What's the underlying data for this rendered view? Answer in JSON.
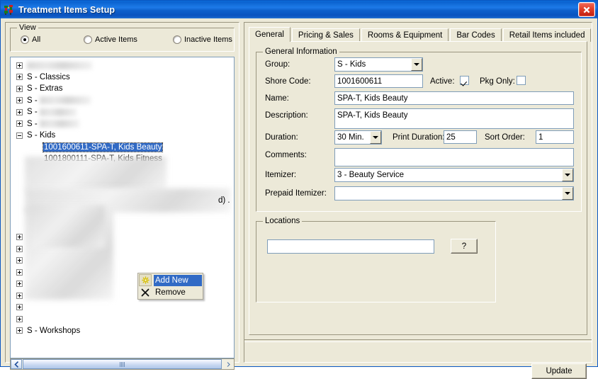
{
  "window": {
    "title": "Treatment Items Setup",
    "icon": "people-icon",
    "close_label": "close-icon"
  },
  "left_pane": {
    "view_group": {
      "label": "View",
      "options": [
        {
          "label": "All",
          "checked": true
        },
        {
          "label": "Active Items",
          "checked": false
        },
        {
          "label": "Inactive Items",
          "checked": false
        }
      ]
    },
    "tree": {
      "nodes": [
        {
          "label": "",
          "redacted": true,
          "state": "plus",
          "depth": 0
        },
        {
          "label": "S - Classics",
          "redacted": false,
          "state": "plus",
          "depth": 0
        },
        {
          "label": "S - Extras",
          "redacted": false,
          "state": "plus",
          "depth": 0
        },
        {
          "label": "S - ",
          "redacted": true,
          "state": "plus",
          "depth": 0
        },
        {
          "label": "S - ",
          "redacted": true,
          "state": "plus",
          "depth": 0
        },
        {
          "label": "S - ",
          "redacted": true,
          "state": "plus",
          "depth": 0
        },
        {
          "label": "S - Kids",
          "redacted": false,
          "state": "minus",
          "depth": 0
        },
        {
          "label": "1001600611-SPA-T, Kids Beauty",
          "redacted": false,
          "state": "leaf",
          "depth": 1,
          "selected": true
        },
        {
          "label": "1001800111-SPA-T, Kids Fitness",
          "redacted": false,
          "state": "leaf",
          "depth": 1,
          "selected": false
        },
        {
          "label": "",
          "redacted": true,
          "state": "plus",
          "depth": 0
        },
        {
          "label": "",
          "redacted": true,
          "state": "plus",
          "depth": 0
        },
        {
          "label": "",
          "redacted": true,
          "state": "plus",
          "depth": 0
        },
        {
          "label": "",
          "redacted": true,
          "state": "plus",
          "depth": 0
        },
        {
          "label": "",
          "redacted": true,
          "state": "plus",
          "depth": 0
        },
        {
          "label": "",
          "redacted": true,
          "state": "plus",
          "depth": 0
        },
        {
          "label": "",
          "redacted": true,
          "state": "plus",
          "depth": 0
        },
        {
          "label": "",
          "redacted": true,
          "state": "plus",
          "depth": 0
        },
        {
          "label": "S - Workshops",
          "redacted": false,
          "state": "plus",
          "depth": 0
        }
      ],
      "partial_text": "d) ."
    },
    "context_menu": {
      "items": [
        {
          "label": "Add New",
          "icon": "asterisk-icon",
          "highlighted": true
        },
        {
          "label": "Remove",
          "icon": "x-mark-icon",
          "highlighted": false
        }
      ]
    },
    "scrollbar": {
      "left_arrow": "chevron-left-icon",
      "right_arrow": "chevron-right-icon"
    }
  },
  "right_pane": {
    "tabs": [
      {
        "label": "General",
        "active": true
      },
      {
        "label": "Pricing & Sales",
        "active": false
      },
      {
        "label": "Rooms & Equipment",
        "active": false
      },
      {
        "label": "Bar Codes",
        "active": false
      },
      {
        "label": "Retail Items included",
        "active": false
      }
    ],
    "general_information": {
      "legend": "General Information",
      "group": {
        "label": "Group:",
        "value": "S - Kids"
      },
      "shore_code": {
        "label": "Shore Code:",
        "value": "1001600611"
      },
      "active": {
        "label": "Active:",
        "checked": true
      },
      "pkg_only": {
        "label": "Pkg Only:",
        "checked": false
      },
      "name": {
        "label": "Name:",
        "value": "SPA-T, Kids Beauty"
      },
      "description": {
        "label": "Description:",
        "value": "SPA-T, Kids Beauty"
      },
      "duration": {
        "label": "Duration:",
        "value": "30 Min."
      },
      "print_duration": {
        "label": "Print Duration:",
        "value": "25"
      },
      "sort_order": {
        "label": "Sort Order:",
        "value": "1"
      },
      "comments": {
        "label": "Comments:",
        "value": ""
      },
      "itemizer": {
        "label": "Itemizer:",
        "value": "3 - Beauty Service"
      },
      "prepaid_itemizer": {
        "label": "Prepaid Itemizer:",
        "value": ""
      }
    },
    "locations": {
      "legend": "Locations",
      "value": "",
      "help_button": "?"
    },
    "update_button": "Update"
  },
  "colors": {
    "titlebar_blue": "#0b63d0",
    "selection_blue": "#316ac5",
    "face": "#ece9d8",
    "field_border": "#7f9db9",
    "close_red": "#c21e10"
  }
}
